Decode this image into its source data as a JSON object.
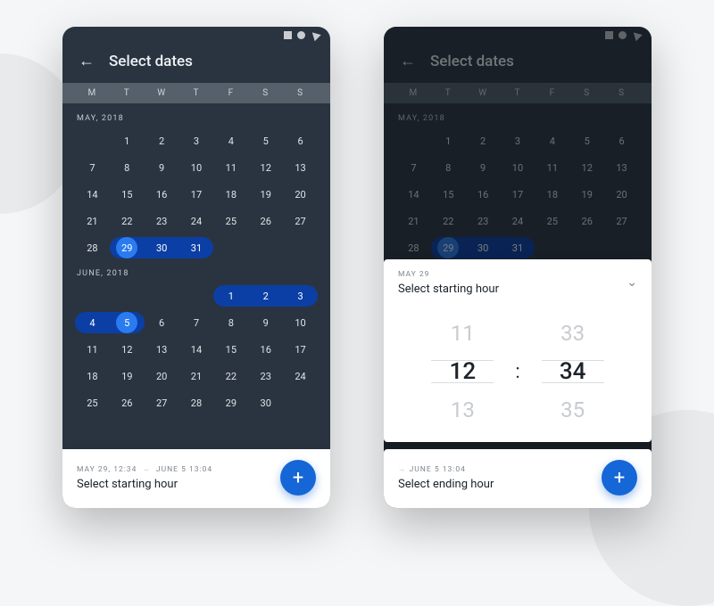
{
  "weekdays": [
    "M",
    "T",
    "W",
    "T",
    "F",
    "S",
    "S"
  ],
  "screen1": {
    "title": "Select dates",
    "month1": {
      "label": "MAY, 2018",
      "leading_blanks": 1,
      "days": 31,
      "range_start": 29,
      "range_end": 31,
      "circle_day": 29
    },
    "month2": {
      "label": "JUNE, 2018",
      "leading_blanks": 4,
      "days": 30,
      "top_range_start": 1,
      "top_range_end": 3,
      "second_range_start": 4,
      "second_range_end": 5,
      "circle_day": 5
    },
    "footer": {
      "start": "MAY 29, 12:34",
      "end": "JUNE 5 13:04",
      "action": "Select starting hour"
    }
  },
  "screen2": {
    "card1": {
      "sub": "MAY 29",
      "title": "Select starting hour",
      "hour_prev": "11",
      "hour": "12",
      "hour_next": "13",
      "min_prev": "33",
      "min": "34",
      "min_next": "35"
    },
    "card2": {
      "sub_end": "JUNE 5 13:04",
      "title": "Select ending hour"
    }
  }
}
